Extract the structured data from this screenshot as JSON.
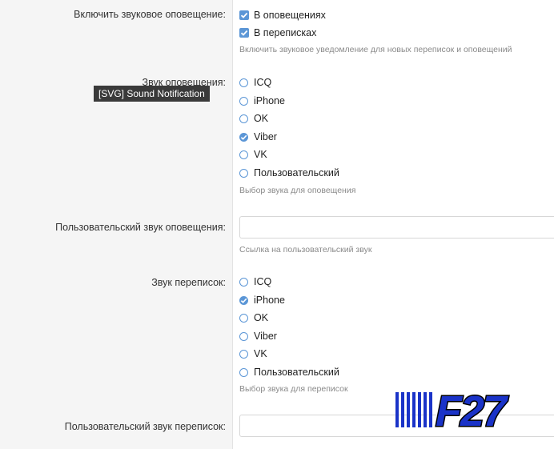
{
  "sound_enable": {
    "label": "Включить звуковое оповещение:",
    "options": [
      {
        "label": "В оповещениях",
        "checked": true
      },
      {
        "label": "В переписках",
        "checked": true
      }
    ],
    "hint": "Включить звуковое уведомление для новых переписок и оповещений"
  },
  "notification_sound": {
    "label": "Звук оповещения:",
    "options": [
      "ICQ",
      "iPhone",
      "OK",
      "Viber",
      "VK",
      "Пользовательский"
    ],
    "selected": "Viber",
    "hint": "Выбор звука для оповещения"
  },
  "custom_notification_sound": {
    "label": "Пользовательский звук оповещения:",
    "value": "",
    "hint": "Ссылка на пользовательский звук"
  },
  "conversation_sound": {
    "label": "Звук переписок:",
    "options": [
      "ICQ",
      "iPhone",
      "OK",
      "Viber",
      "VK",
      "Пользовательский"
    ],
    "selected": "iPhone",
    "hint": "Выбор звука для переписок"
  },
  "custom_conversation_sound": {
    "label": "Пользовательский звук переписок:",
    "value": ""
  },
  "tooltip": {
    "text": "[SVG] Sound Notification"
  },
  "logo": {
    "text": "F27"
  },
  "colors": {
    "accent": "#5b96d6",
    "hint": "#8a8a8a",
    "left_pane": "#f5f5f5",
    "tooltip_bg": "#3a3a3a"
  }
}
